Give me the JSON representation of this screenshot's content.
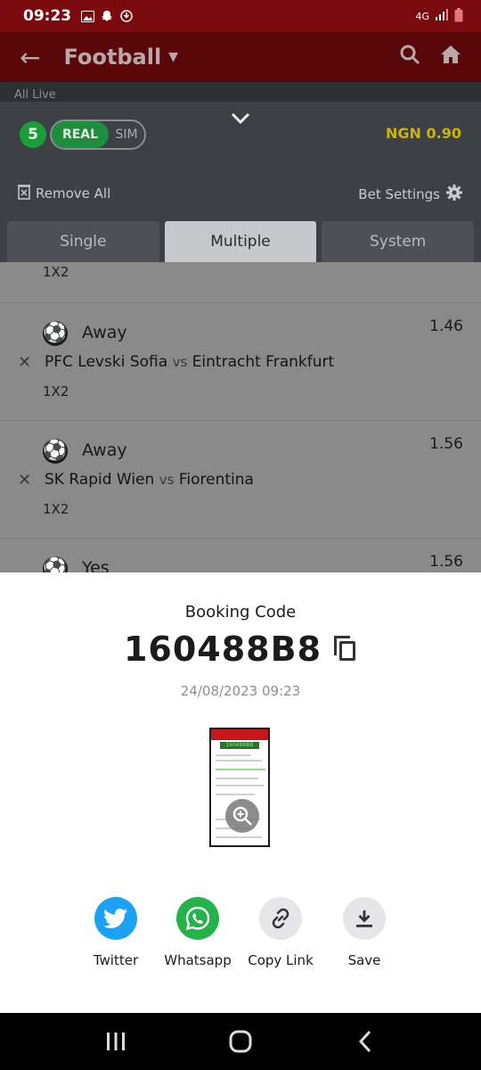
{
  "status_bar": {
    "time": "09:23",
    "network": "4G"
  },
  "header": {
    "title": "Football",
    "subtitle": "All Live"
  },
  "betslip": {
    "count": "5",
    "mode_real": "REAL",
    "mode_sim": "SIM",
    "balance": "NGN 0.90",
    "remove_all": "Remove All",
    "bet_settings": "Bet Settings",
    "tabs": [
      {
        "label": "Single"
      },
      {
        "label": "Multiple"
      },
      {
        "label": "System"
      }
    ],
    "first_market": "1X2",
    "bets": [
      {
        "pick": "Away",
        "home": "PFC Levski Sofia",
        "vs": "vs",
        "away": "Eintracht Frankfurt",
        "market": "1X2",
        "odds": "1.46"
      },
      {
        "pick": "Away",
        "home": "SK Rapid Wien",
        "vs": "vs",
        "away": "Fiorentina",
        "market": "1X2",
        "odds": "1.56"
      },
      {
        "pick": "Yes",
        "home": "",
        "vs": "",
        "away": "",
        "market": "",
        "odds": "1.56"
      }
    ]
  },
  "booking": {
    "label": "Booking Code",
    "code": "160488B8",
    "datetime": "24/08/2023 09:23",
    "thumb_code": "160488B8"
  },
  "share": {
    "twitter": "Twitter",
    "whatsapp": "Whatsapp",
    "copy_link": "Copy Link",
    "save": "Save"
  },
  "colors": {
    "brand_red": "#7a0a0e",
    "real_green": "#1e8e3e",
    "balance_yellow": "#c9b21a",
    "twitter_blue": "#1da1f2",
    "whatsapp_green": "#25b24b"
  }
}
